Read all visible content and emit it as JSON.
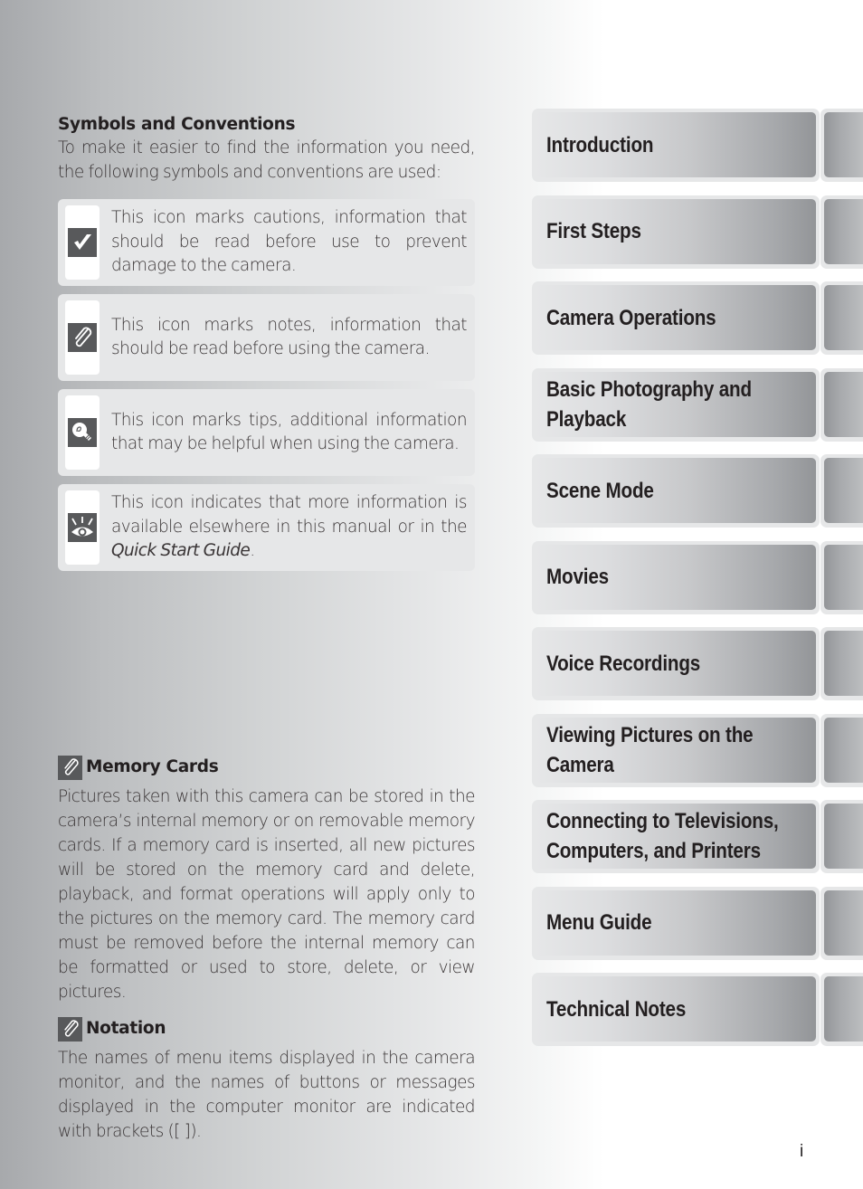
{
  "symbols_section": {
    "heading": "Symbols and Conventions",
    "intro": "To make it easier to find the information you need, the following symbols and conventions are used:",
    "items": [
      {
        "icon": "checkmark-caution-icon",
        "text": "This icon marks cautions, information that should be read before use to prevent damage to the camera."
      },
      {
        "icon": "paperclip-note-icon",
        "text": "This icon marks notes, information that should be read before using the camera."
      },
      {
        "icon": "lightbulb-tip-icon",
        "text": "This icon marks tips, additional information that may be helpful when using the camera."
      },
      {
        "icon": "eye-reference-icon",
        "text_before": "This icon indicates that more information is available elsewhere in this manual or in the ",
        "text_italic": "Quick Start Guide",
        "text_after": "."
      }
    ]
  },
  "memory_cards": {
    "icon": "paperclip-note-icon",
    "heading": "Memory Cards",
    "body": "Pictures taken with this camera can be stored in the camera’s internal memory or on removable memory cards.  If a memory card is inserted, all new pictures will be stored on the memory card and delete, playback, and format operations will apply only to the pictures on the memory card.  The memory card must be removed before the internal memory can be formatted or used to store, delete, or view pictures."
  },
  "notation": {
    "icon": "paperclip-note-icon",
    "heading": "Notation",
    "body": "The names of menu items displayed in the camera monitor, and the names of buttons or messages displayed in the computer monitor are indicated with brackets ([ ])."
  },
  "chapter_tabs": [
    {
      "line1": "Introduction",
      "line2": ""
    },
    {
      "line1": "First Steps",
      "line2": ""
    },
    {
      "line1": "Camera Operations",
      "line2": ""
    },
    {
      "line1": "Basic Photography and",
      "line2": "Playback"
    },
    {
      "line1": "Scene Mode",
      "line2": ""
    },
    {
      "line1": "Movies",
      "line2": ""
    },
    {
      "line1": "Voice Recordings",
      "line2": ""
    },
    {
      "line1": "Viewing Pictures on the",
      "line2": "Camera"
    },
    {
      "line1": "Connecting to Televisions,",
      "line2": "Computers, and Printers"
    },
    {
      "line1": "Menu Guide",
      "line2": ""
    },
    {
      "line1": "Technical Notes",
      "line2": ""
    }
  ],
  "page_number": "i",
  "colors": {
    "icon_bg": "#58595b",
    "box_bg": "#e6e7e8",
    "text": "#231f20"
  }
}
